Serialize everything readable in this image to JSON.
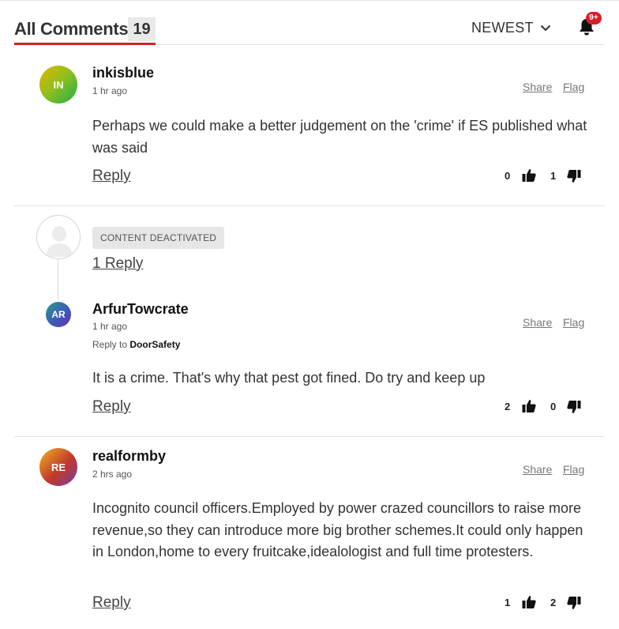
{
  "header": {
    "title": "All Comments",
    "count": "19",
    "sort_label": "NEWEST",
    "notification_badge": "9+",
    "accent_color": "#d71f2b"
  },
  "comments": [
    {
      "initials": "IN",
      "username": "inkisblue",
      "time": "1 hr ago",
      "share": "Share",
      "flag": "Flag",
      "text": "Perhaps we could make a better judgement on the 'crime' if ES published what was said",
      "reply": "Reply",
      "likes": "0",
      "dislikes": "1"
    },
    {
      "deactivated_label": "CONTENT DEACTIVATED",
      "replies_link": "1 Reply"
    },
    {
      "initials": "AR",
      "username": "ArfurTowcrate",
      "time": "1 hr ago",
      "reply_to_prefix": "Reply to",
      "reply_to_user": "DoorSafety",
      "share": "Share",
      "flag": "Flag",
      "text": "It is a crime. That's why that pest got fined. Do try and keep up",
      "reply": "Reply",
      "likes": "2",
      "dislikes": "0"
    },
    {
      "initials": "RE",
      "username": "realformby",
      "time": "2 hrs ago",
      "share": "Share",
      "flag": "Flag",
      "text": "Incognito council officers.Employed by power crazed councillors to raise more revenue,so they can introduce more big brother schemes.It could only happen in London,home to every fruitcake,idealologist and full time protesters.",
      "reply": "Reply",
      "likes": "1",
      "dislikes": "2"
    }
  ],
  "icons": {
    "sort": "chevron-down-icon",
    "notifications": "bell-icon",
    "like": "thumbs-up-icon",
    "dislike": "thumbs-down-icon",
    "deactivated_avatar": "user-silhouette-icon"
  }
}
